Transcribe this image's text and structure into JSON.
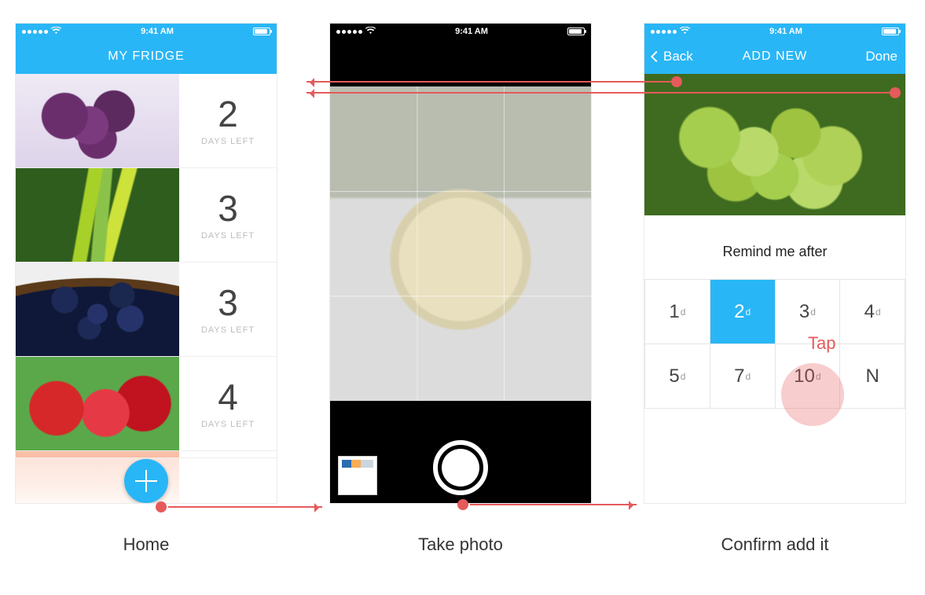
{
  "status": {
    "time": "9:41 AM"
  },
  "home": {
    "title": "MY FRIDGE",
    "items": [
      {
        "days": "2",
        "label": "DAYS LEFT",
        "photo": "grapes"
      },
      {
        "days": "3",
        "label": "DAYS LEFT",
        "photo": "bananas"
      },
      {
        "days": "3",
        "label": "DAYS LEFT",
        "photo": "blueberries"
      },
      {
        "days": "4",
        "label": "DAYS LEFT",
        "photo": "strawberries"
      }
    ]
  },
  "confirm": {
    "title": "ADD NEW",
    "back": "Back",
    "done": "Done",
    "remind_label": "Remind me after",
    "selected_index": 1,
    "options": [
      {
        "num": "1",
        "unit": "d"
      },
      {
        "num": "2",
        "unit": "d"
      },
      {
        "num": "3",
        "unit": "d"
      },
      {
        "num": "4",
        "unit": "d"
      },
      {
        "num": "5",
        "unit": "d"
      },
      {
        "num": "7",
        "unit": "d"
      },
      {
        "num": "10",
        "unit": "d"
      },
      {
        "num": "N",
        "unit": ""
      }
    ]
  },
  "annotations": {
    "tap": "Tap"
  },
  "captions": {
    "home": "Home",
    "camera": "Take photo",
    "confirm": "Confirm add it"
  }
}
